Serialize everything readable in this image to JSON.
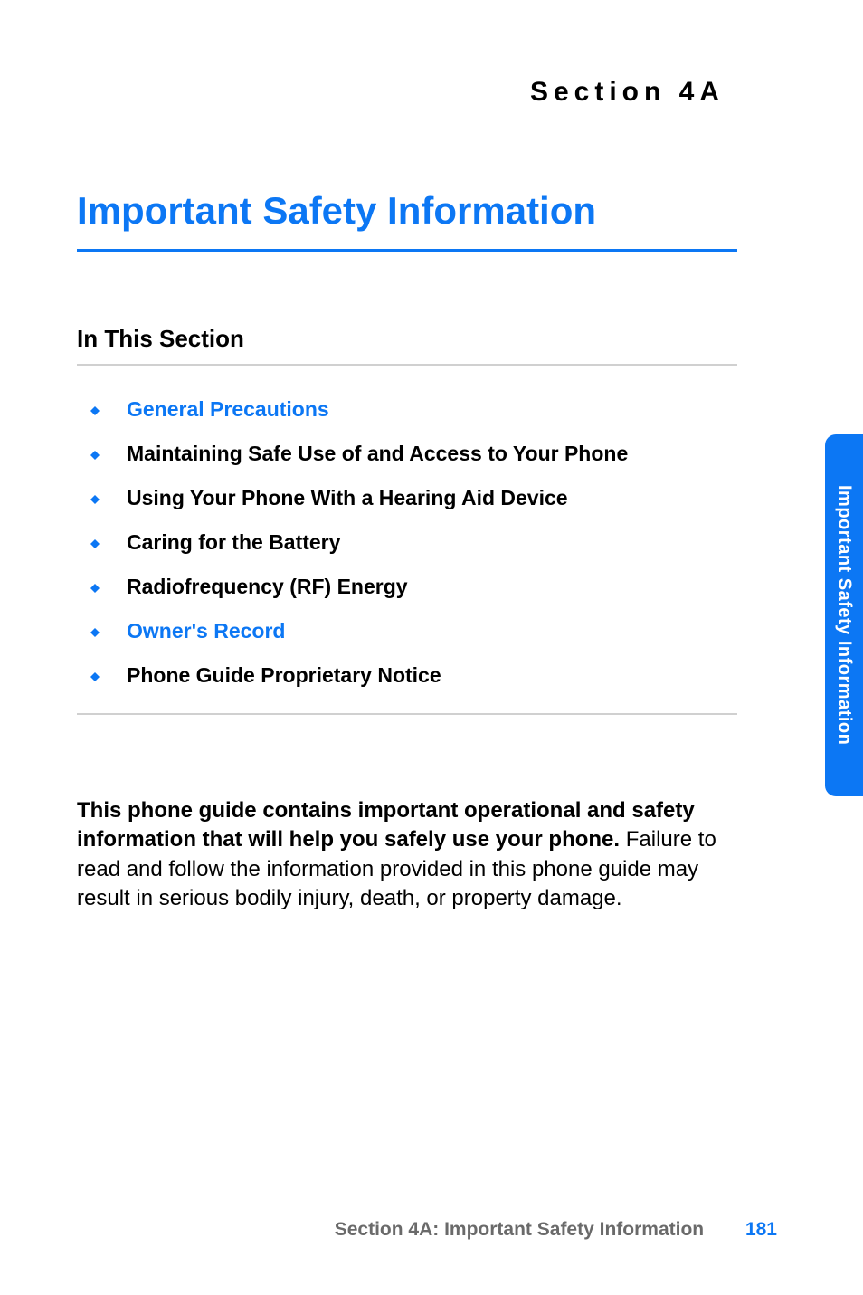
{
  "header": {
    "section_label": "Section 4A"
  },
  "title": "Important Safety Information",
  "subheading": "In This Section",
  "toc": [
    {
      "label": "General Precautions",
      "highlight": true
    },
    {
      "label": "Maintaining Safe Use of and Access to Your Phone",
      "highlight": false
    },
    {
      "label": "Using Your Phone With a Hearing Aid Device",
      "highlight": false
    },
    {
      "label": "Caring for the Battery",
      "highlight": false
    },
    {
      "label": "Radiofrequency (RF) Energy",
      "highlight": false
    },
    {
      "label": "Owner's Record",
      "highlight": true
    },
    {
      "label": "Phone Guide Proprietary Notice",
      "highlight": false
    }
  ],
  "body": {
    "lead": "This phone guide contains important operational and safety information that will help you safely use your phone.",
    "rest": " Failure to read and follow the information provided in this phone guide may result in serious bodily injury, death, or property damage."
  },
  "side_tab": "Important Safety Information",
  "footer": {
    "text": "Section 4A: Important Safety Information",
    "page": "181"
  },
  "colors": {
    "accent": "#0c77f4",
    "text": "#000000",
    "muted": "#6a6a6a",
    "divider": "#d0d0d0"
  }
}
